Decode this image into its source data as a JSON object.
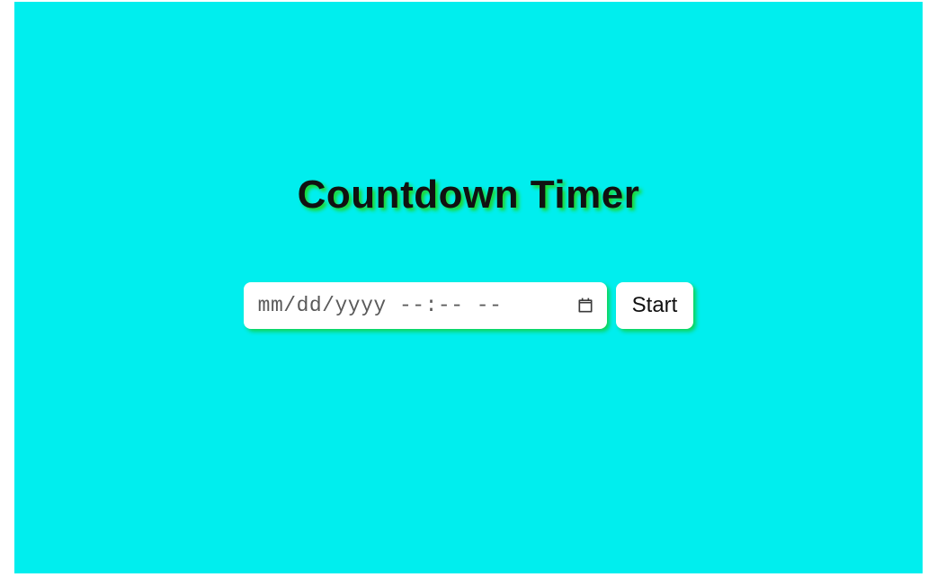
{
  "title": "Countdown Timer",
  "datetime_input": {
    "placeholder": "mm/dd/yyyy --:-- --",
    "value": ""
  },
  "start_button_label": "Start",
  "colors": {
    "background": "#00eeee",
    "shadow": "#1fd61f"
  }
}
